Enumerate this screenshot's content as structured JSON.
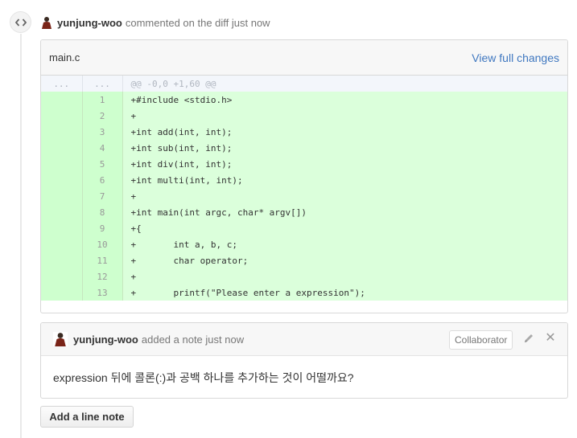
{
  "comment_header": {
    "author": "yunjung-woo",
    "action": "commented on the diff just now"
  },
  "diff": {
    "filename": "main.c",
    "view_link": "View full changes",
    "hunk": {
      "old_num": "...",
      "new_num": "...",
      "text": "@@ -0,0 +1,60 @@"
    },
    "lines": [
      {
        "num": "1",
        "text": "+#include <stdio.h>"
      },
      {
        "num": "2",
        "text": "+"
      },
      {
        "num": "3",
        "text": "+int add(int, int);"
      },
      {
        "num": "4",
        "text": "+int sub(int, int);"
      },
      {
        "num": "5",
        "text": "+int div(int, int);"
      },
      {
        "num": "6",
        "text": "+int multi(int, int);"
      },
      {
        "num": "7",
        "text": "+"
      },
      {
        "num": "8",
        "text": "+int main(int argc, char* argv[])"
      },
      {
        "num": "9",
        "text": "+{"
      },
      {
        "num": "10",
        "text": "+       int a, b, c;"
      },
      {
        "num": "11",
        "text": "+       char operator;"
      },
      {
        "num": "12",
        "text": "+"
      },
      {
        "num": "13",
        "text": "+       printf(\"Please enter a expression\");"
      }
    ]
  },
  "note": {
    "author": "yunjung-woo",
    "action": "added a note just now",
    "badge": "Collaborator",
    "body": "expression 뒤에 콜론(:)과 공백 하나를 추가하는 것이 어떨까요?"
  },
  "add_note_button": "Add a line note",
  "colors": {
    "link": "#4078c0",
    "added_line_bg": "#dbffdb",
    "added_gutter_bg": "#ceffce",
    "hunk_bg": "#f3f6fb"
  }
}
